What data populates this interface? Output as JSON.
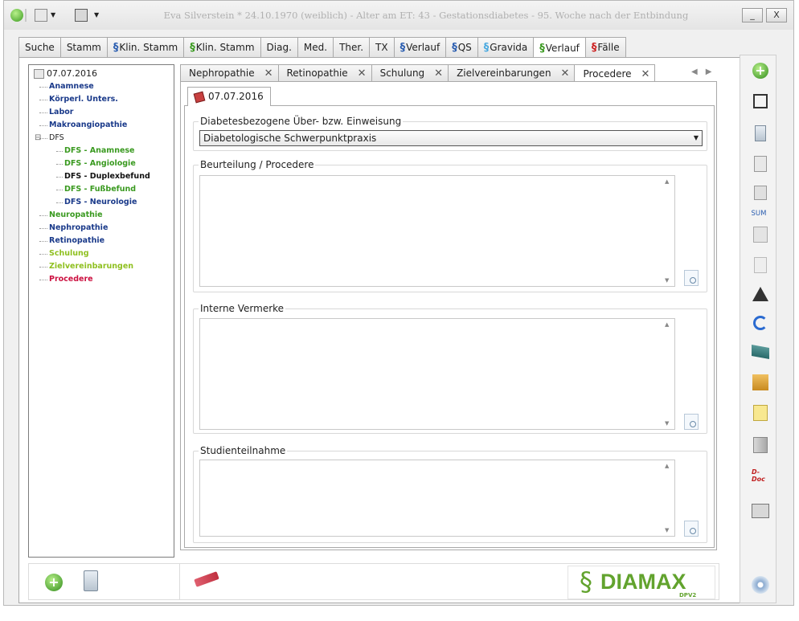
{
  "window": {
    "title": "Eva Silverstein  * 24.10.1970 (weiblich) - Alter am ET: 43 - Gestationsdiabetes - 95. Woche nach der Entbindung",
    "minimize": "_",
    "close": "X"
  },
  "main_tabs": [
    {
      "label": "Suche",
      "icon": null,
      "color": null
    },
    {
      "label": "Stamm",
      "icon": null,
      "color": null
    },
    {
      "label": "Klin. Stamm",
      "icon": "caduceus",
      "color": "#2a5db0"
    },
    {
      "label": "Klin. Stamm",
      "icon": "caduceus",
      "color": "#3a9a20"
    },
    {
      "label": "Diag.",
      "icon": null,
      "color": null
    },
    {
      "label": "Med.",
      "icon": null,
      "color": null
    },
    {
      "label": "Ther.",
      "icon": null,
      "color": null
    },
    {
      "label": "TX",
      "icon": null,
      "color": null
    },
    {
      "label": "Verlauf",
      "icon": "caduceus",
      "color": "#2a5db0"
    },
    {
      "label": "QS",
      "icon": "caduceus",
      "color": "#2a5db0"
    },
    {
      "label": "Gravida",
      "icon": "caduceus",
      "color": "#49a9e0"
    },
    {
      "label": "Verlauf",
      "icon": "caduceus",
      "color": "#3a9a20",
      "active": true
    },
    {
      "label": "Fälle",
      "icon": "caduceus",
      "color": "#cc2020"
    }
  ],
  "tree": {
    "root": "07.07.2016",
    "nodes": [
      {
        "label": "Anamnese",
        "color": "#1a3a8a",
        "level": 1
      },
      {
        "label": "Körperl. Unters.",
        "color": "#1a3a8a",
        "level": 1
      },
      {
        "label": "Labor",
        "color": "#1a3a8a",
        "level": 1
      },
      {
        "label": "Makroangiopathie",
        "color": "#1a3a8a",
        "level": 1
      },
      {
        "label": "DFS",
        "color": "#222222",
        "level": 1,
        "expander": "⊟"
      },
      {
        "label": "DFS - Anamnese",
        "color": "#3a9a20",
        "level": 2
      },
      {
        "label": "DFS - Angiologie",
        "color": "#3a9a20",
        "level": 2
      },
      {
        "label": "DFS - Duplexbefund",
        "color": "#111111",
        "level": 2
      },
      {
        "label": "DFS - Fußbefund",
        "color": "#3a9a20",
        "level": 2
      },
      {
        "label": "DFS - Neurologie",
        "color": "#1a3a8a",
        "level": 2
      },
      {
        "label": "Neuropathie",
        "color": "#3a9a20",
        "level": 1
      },
      {
        "label": "Nephropathie",
        "color": "#1a3a8a",
        "level": 1
      },
      {
        "label": "Retinopathie",
        "color": "#1a3a8a",
        "level": 1
      },
      {
        "label": "Schulung",
        "color": "#8fc020",
        "level": 1
      },
      {
        "label": "Zielvereinbarungen",
        "color": "#8fc020",
        "level": 1
      },
      {
        "label": "Procedere",
        "color": "#cc1040",
        "level": 1
      }
    ]
  },
  "inner_tabs": [
    {
      "label": "Nephropathie",
      "close": "✕"
    },
    {
      "label": "Retinopathie",
      "close": "✕"
    },
    {
      "label": "Schulung",
      "close": "✕"
    },
    {
      "label": "Zielvereinbarungen",
      "close": "✕"
    },
    {
      "label": "Procedere",
      "close": "✕",
      "active": true
    }
  ],
  "nav_arrows": "◀▶",
  "date_tab": "07.07.2016",
  "form": {
    "einweisung_label": "Diabetesbezogene Über- bzw. Einweisung",
    "einweisung_value": "Diabetologische Schwerpunktpraxis",
    "beurteilung_label": "Beurteilung / Procedere",
    "beurteilung_value": "",
    "vermerke_label": "Interne Vermerke",
    "vermerke_value": "",
    "studien_label": "Studienteilnahme",
    "studien_value": ""
  },
  "toolbar": {
    "sum_label": "SUM",
    "ddoc_label": "D-Doc"
  },
  "logo": {
    "text": "DIAMAX",
    "sub": "DPV2"
  }
}
